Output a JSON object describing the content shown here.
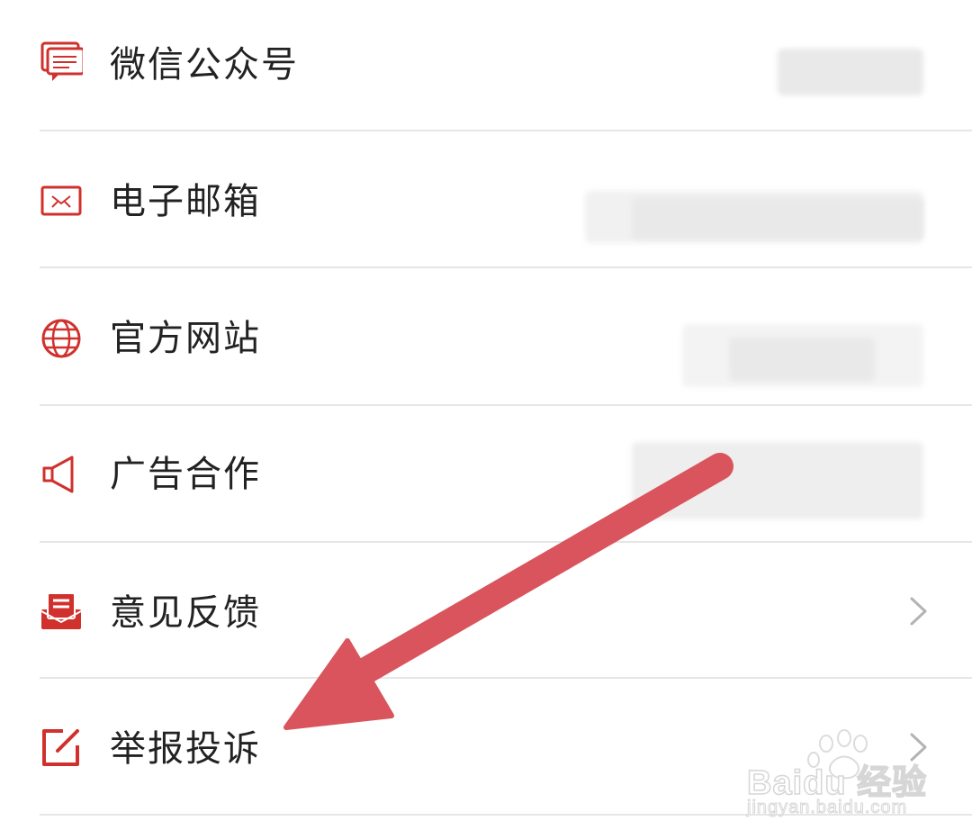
{
  "items": [
    {
      "label": "微信公众号",
      "icon": "wechat-official-account-icon",
      "has_value": true,
      "has_chevron": false
    },
    {
      "label": "电子邮箱",
      "icon": "mail-icon",
      "has_value": true,
      "has_chevron": false
    },
    {
      "label": "官方网站",
      "icon": "globe-icon",
      "has_value": true,
      "has_chevron": false
    },
    {
      "label": "广告合作",
      "icon": "megaphone-icon",
      "has_value": true,
      "has_chevron": false
    },
    {
      "label": "意见反馈",
      "icon": "feedback-envelope-icon",
      "has_value": false,
      "has_chevron": true
    },
    {
      "label": "举报投诉",
      "icon": "report-edit-icon",
      "has_value": false,
      "has_chevron": true
    }
  ],
  "annotation": {
    "type": "arrow",
    "color": "#d9545c",
    "points_to": "举报投诉"
  },
  "watermark": {
    "brand": "Baidu 经验",
    "url": "jingyan.baidu.com"
  },
  "accent_color": "#d0312d"
}
